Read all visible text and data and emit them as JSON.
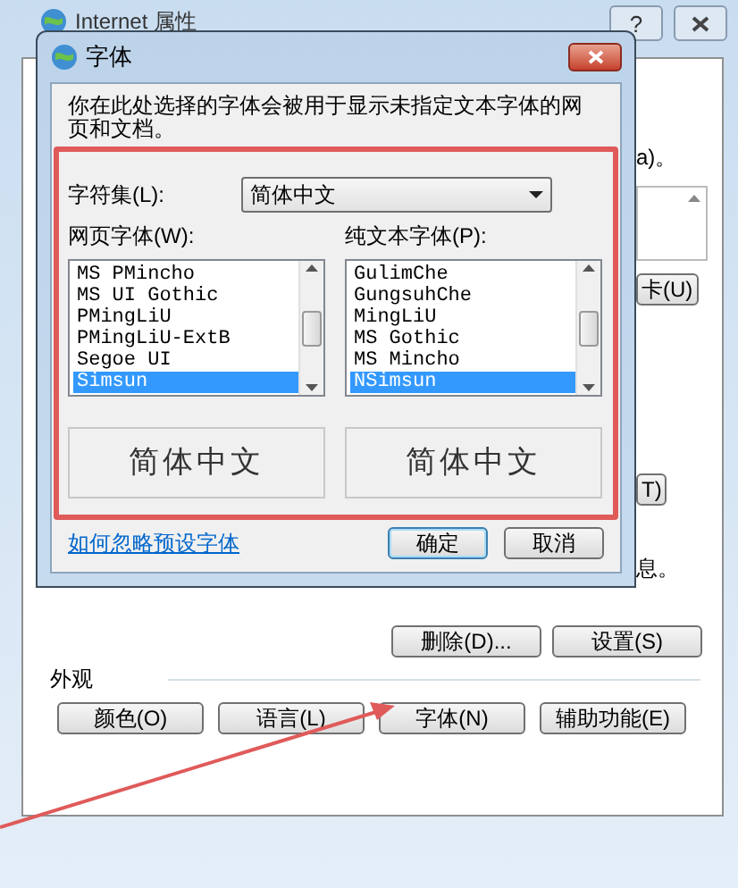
{
  "window": {
    "title": "Internet 属性",
    "help": "?"
  },
  "partial_texts": [
    {
      "kind": "text",
      "text": "a)。"
    },
    {
      "kind": "list"
    },
    {
      "kind": "button",
      "text": "卡(U)"
    },
    {
      "kind": "button",
      "text": "T)"
    },
    {
      "kind": "text",
      "text": "息。"
    }
  ],
  "action_buttons": [
    "删除(D)...",
    "设置(S)"
  ],
  "appearance": {
    "title": "外观",
    "buttons": [
      "颜色(O)",
      "语言(L)",
      "字体(N)",
      "辅助功能(E)"
    ]
  },
  "dialog": {
    "title": "字体",
    "description": "你在此处选择的字体会被用于显示未指定文本字体的网页和文档。",
    "charset": {
      "label": "字符集(L):",
      "value": "简体中文"
    },
    "lists": [
      {
        "label": "网页字体(W):",
        "items": [
          {
            "text": "MS PMincho",
            "selected": false
          },
          {
            "text": "MS UI Gothic",
            "selected": false
          },
          {
            "text": "PMingLiU",
            "selected": false
          },
          {
            "text": "PMingLiU-ExtB",
            "selected": false
          },
          {
            "text": "Segoe UI",
            "selected": false
          },
          {
            "text": "Simsun",
            "selected": true
          }
        ]
      },
      {
        "label": "纯文本字体(P):",
        "items": [
          {
            "text": "GulimChe",
            "selected": false
          },
          {
            "text": "GungsuhChe",
            "selected": false
          },
          {
            "text": "MingLiU",
            "selected": false
          },
          {
            "text": "MS Gothic",
            "selected": false
          },
          {
            "text": "MS Mincho",
            "selected": false
          },
          {
            "text": "NSimsun",
            "selected": true
          }
        ]
      }
    ],
    "previews": [
      "简体中文",
      "简体中文"
    ],
    "link": "如何忽略预设字体",
    "buttons": [
      {
        "label": "确定",
        "default": true
      },
      {
        "label": "取消",
        "default": false
      }
    ]
  }
}
